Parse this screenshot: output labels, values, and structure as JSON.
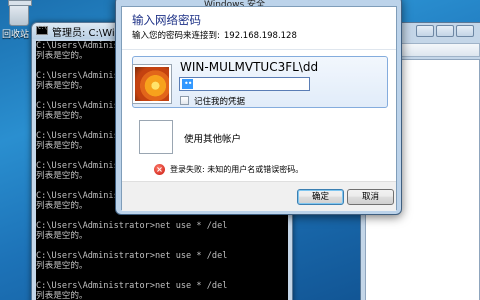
{
  "desktop": {
    "recycle_bin_label": "回收站"
  },
  "console": {
    "title": "管理员: C:\\Windows",
    "lines": [
      "C:\\Users\\Administrator>net use * /del",
      "列表是空的。",
      "",
      "C:\\Users\\Administrator>net use * /del",
      "列表是空的。",
      "",
      "C:\\Users\\Administrator>net use * /del",
      "列表是空的。",
      "",
      "C:\\Users\\Administrator>net use * /del",
      "列表是空的。",
      "",
      "C:\\Users\\Administrator>net use * /del",
      "列表是空的。",
      "",
      "C:\\Users\\Administrator>net use * /del",
      "列表是空的。",
      "",
      "C:\\Users\\Administrator>net use * /del",
      "列表是空的。",
      "",
      "C:\\Users\\Administrator>net use * /del",
      "列表是空的。",
      "",
      "C:\\Users\\Administrator>net use * /del",
      "列表是空的。"
    ]
  },
  "dialog": {
    "title": "Windows 安全",
    "heading": "输入网络密码",
    "subtitle": "输入您的密码来连接到:",
    "host": "192.168.198.128",
    "user_name": "WIN-MULMVTUC3FL\\dd",
    "password_value": "••",
    "remember_label": "记住我的凭据",
    "remember_checked": false,
    "other_account_label": "使用其他帐户",
    "error_text": "登录失败: 未知的用户名或错误密码。",
    "ok_label": "确定",
    "cancel_label": "取消"
  }
}
